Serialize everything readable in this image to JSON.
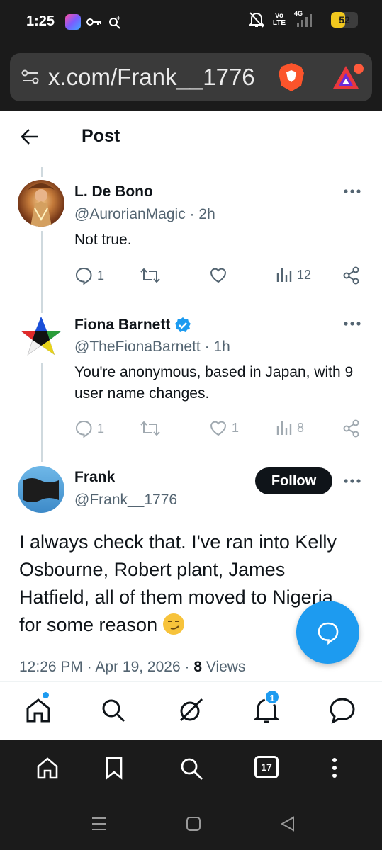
{
  "status_bar": {
    "time": "1:25",
    "volte_top": "Vo",
    "volte_bottom": "LTE",
    "network": "4G",
    "battery": "52",
    "battery_level": 0.52,
    "icons": [
      "app-badge-icon",
      "key-icon",
      "location-search-icon",
      "mute-icon",
      "signal-icon"
    ]
  },
  "browser": {
    "url": "x.com/Frank__1776",
    "icons": [
      "site-settings-icon",
      "brave-shield-icon",
      "brave-rewards-icon"
    ]
  },
  "header": {
    "title": "Post"
  },
  "replies": [
    {
      "name": "L. De Bono",
      "handle": "@AurorianMagic",
      "time": "2h",
      "text": "Not true.",
      "replies": "1",
      "reposts": "",
      "likes": "",
      "views": "12",
      "verified": false
    },
    {
      "name": "Fiona Barnett",
      "handle": "@TheFionaBarnett",
      "time": "1h",
      "text": "You're anonymous, based in Japan, with 9 user name changes.",
      "replies": "1",
      "reposts": "",
      "likes": "1",
      "views": "8",
      "verified": true
    }
  ],
  "main_post": {
    "name": "Frank",
    "handle": "@Frank__1776",
    "follow_label": "Follow",
    "text": "I always check that. I've ran into Kelly Osbourne, Robert plant, James Hatfield, all of them moved to Nigeria for some reason",
    "emoji": "smirking-face",
    "timestamp": "12:26 PM · Apr 19, 2026 · ",
    "views_count": "8",
    "views_label": " Views"
  },
  "x_nav": {
    "items": [
      "home-icon",
      "search-icon",
      "grok-icon",
      "notifications-icon",
      "messages-icon"
    ],
    "notifications_count": "1"
  },
  "browser_toolbar": {
    "items": [
      "home-icon",
      "bookmark-icon",
      "search-icon",
      "tabs-icon",
      "menu-icon"
    ],
    "tab_count": "17"
  },
  "colors": {
    "accent": "#1d9bf0",
    "text": "#0f1419",
    "secondary_text": "#536471",
    "chrome_dark": "#1b1b1b"
  }
}
